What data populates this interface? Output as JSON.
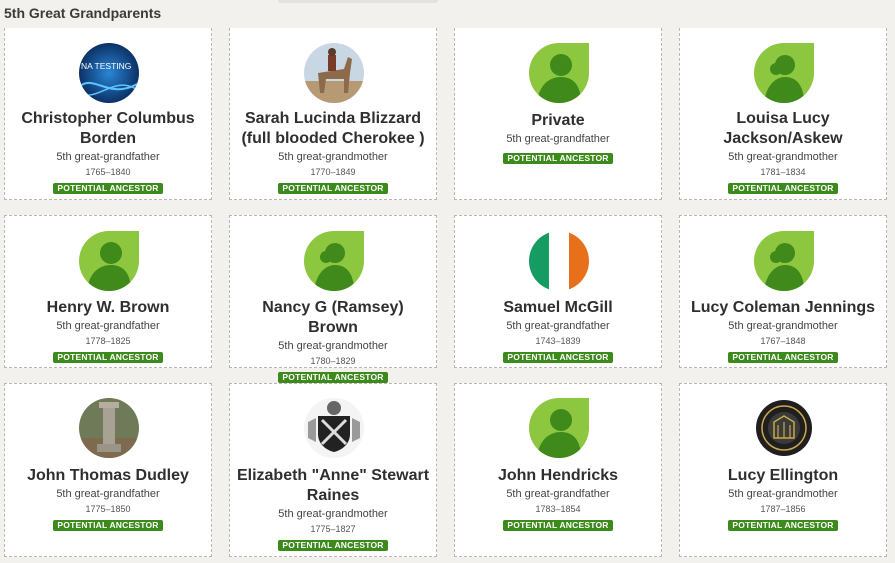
{
  "section": {
    "title": "5th Great Grandparents"
  },
  "cards": [
    {
      "name": "Christopher Columbus Borden",
      "relation": "5th great-grandfather",
      "years": "1765–1840",
      "badge": "POTENTIAL ANCESTOR",
      "photo": "dna-testing-photo",
      "photo_text": "NA TESTING"
    },
    {
      "name": "Sarah Lucinda Blizzard (full blooded Cherokee )",
      "relation": "5th great-grandmother",
      "years": "1770–1849",
      "badge": "POTENTIAL ANCESTOR",
      "photo": "horse-rider-photo"
    },
    {
      "name": "Private",
      "relation": "5th great-grandfather",
      "years": "",
      "badge": "POTENTIAL ANCESTOR",
      "photo": "male-silhouette-icon"
    },
    {
      "name": "Louisa Lucy Jackson/Askew",
      "relation": "5th great-grandmother",
      "years": "1781–1834",
      "badge": "POTENTIAL ANCESTOR",
      "photo": "female-silhouette-icon"
    },
    {
      "name": "Henry W. Brown",
      "relation": "5th great-grandfather",
      "years": "1778–1825",
      "badge": "POTENTIAL ANCESTOR",
      "photo": "male-silhouette-icon"
    },
    {
      "name": "Nancy G (Ramsey) Brown",
      "relation": "5th great-grandmother",
      "years": "1780–1829",
      "badge": "POTENTIAL ANCESTOR",
      "photo": "female-silhouette-icon"
    },
    {
      "name": "Samuel McGill",
      "relation": "5th great-grandfather",
      "years": "1743–1839",
      "badge": "POTENTIAL ANCESTOR",
      "photo": "irish-flag-photo"
    },
    {
      "name": "Lucy Coleman Jennings",
      "relation": "5th great-grandmother",
      "years": "1767–1848",
      "badge": "POTENTIAL ANCESTOR",
      "photo": "female-silhouette-icon"
    },
    {
      "name": "John Thomas Dudley",
      "relation": "5th great-grandfather",
      "years": "1775–1850",
      "badge": "POTENTIAL ANCESTOR",
      "photo": "gravestone-photo"
    },
    {
      "name": "Elizabeth \"Anne\" Stewart Raines",
      "relation": "5th great-grandmother",
      "years": "1775–1827",
      "badge": "POTENTIAL ANCESTOR",
      "photo": "coat-of-arms-photo"
    },
    {
      "name": "John Hendricks",
      "relation": "5th great-grandfather",
      "years": "1783–1854",
      "badge": "POTENTIAL ANCESTOR",
      "photo": "male-silhouette-icon"
    },
    {
      "name": "Lucy Ellington",
      "relation": "5th great-grandmother",
      "years": "1787–1856",
      "badge": "POTENTIAL ANCESTOR",
      "photo": "state-seal-photo"
    }
  ],
  "colors": {
    "badge_green": "#3c8a1b",
    "leaf_green": "#8dc63f",
    "leaf_dark": "#3f8a1a"
  }
}
